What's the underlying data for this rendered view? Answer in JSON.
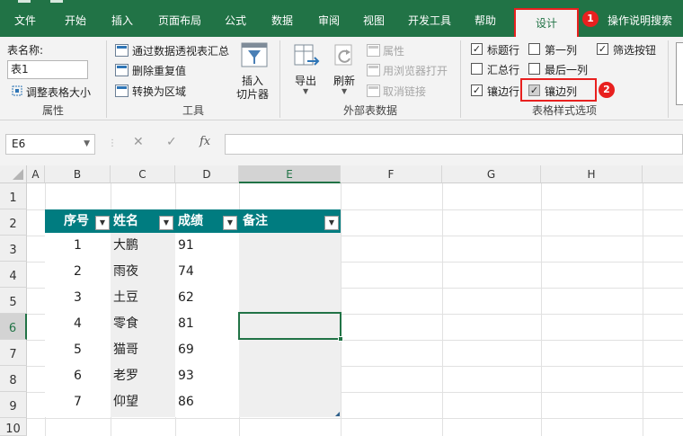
{
  "tabs": {
    "file": "文件",
    "home": "开始",
    "insert": "插入",
    "layout": "页面布局",
    "formulas": "公式",
    "data": "数据",
    "review": "审阅",
    "view": "视图",
    "developer": "开发工具",
    "help": "帮助",
    "design": "设计",
    "tellme": "操作说明搜索"
  },
  "badges": {
    "one": "1",
    "two": "2"
  },
  "ribbon": {
    "properties": {
      "table_name_label": "表名称:",
      "table_name_value": "表1",
      "resize": "调整表格大小",
      "group": "属性"
    },
    "tools": {
      "pivot": "通过数据透视表汇总",
      "dedupe": "删除重复值",
      "convert": "转换为区域",
      "slicer_line1": "插入",
      "slicer_line2": "切片器",
      "group": "工具"
    },
    "external": {
      "export": "导出",
      "refresh": "刷新",
      "props": "属性",
      "browser": "用浏览器打开",
      "unlink": "取消链接",
      "group": "外部表数据"
    },
    "styleopts": {
      "header_row": "标题行",
      "total_row": "汇总行",
      "banded_rows": "镶边行",
      "first_col": "第一列",
      "last_col": "最后一列",
      "banded_cols": "镶边列",
      "filter_btn": "筛选按钮",
      "group": "表格样式选项"
    }
  },
  "formula_bar": {
    "name_box": "E6",
    "cancel": "✕",
    "enter": "✓",
    "fx": "fx",
    "formula": ""
  },
  "columns": [
    "A",
    "B",
    "C",
    "D",
    "E",
    "F",
    "G",
    "H"
  ],
  "rows": [
    "1",
    "2",
    "3",
    "4",
    "5",
    "6",
    "7",
    "8",
    "9",
    "10"
  ],
  "table": {
    "headers": [
      "序号",
      "姓名",
      "成绩",
      "备注"
    ],
    "rows": [
      [
        "1",
        "大鹏",
        "91",
        ""
      ],
      [
        "2",
        "雨夜",
        "74",
        ""
      ],
      [
        "3",
        "土豆",
        "62",
        ""
      ],
      [
        "4",
        "零食",
        "81",
        ""
      ],
      [
        "5",
        "猫哥",
        "69",
        ""
      ],
      [
        "6",
        "老罗",
        "93",
        ""
      ],
      [
        "7",
        "仰望",
        "86",
        ""
      ]
    ]
  },
  "colors": {
    "excel_green": "#217346",
    "table_header": "#007c80",
    "highlight": "#e8201f"
  }
}
